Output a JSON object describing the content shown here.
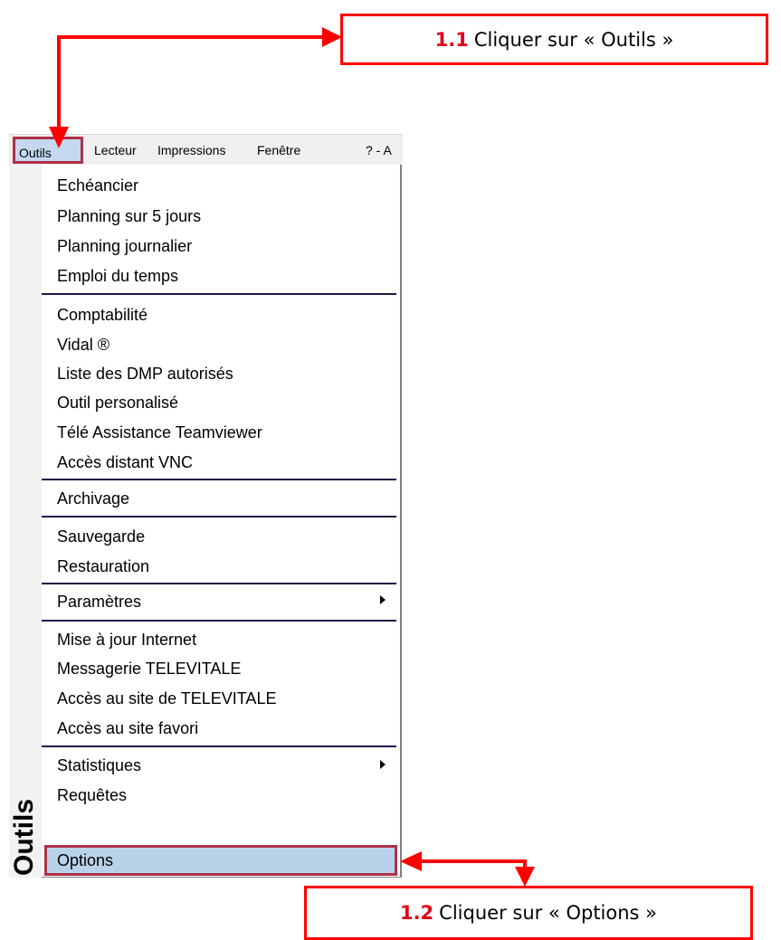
{
  "callouts": {
    "first": {
      "step": "1.1",
      "text": "Cliquer sur « Outils »"
    },
    "second": {
      "step": "1.2",
      "text": "Cliquer sur « Options »"
    }
  },
  "menubar": {
    "items": [
      "Outils",
      "Lecteur",
      "Impressions",
      "Fenêtre",
      "? - A"
    ]
  },
  "sidebar": {
    "label": "Outils"
  },
  "menu": {
    "groups": [
      [
        "Echéancier",
        "Planning sur 5 jours",
        "Planning journalier",
        "Emploi du temps"
      ],
      [
        "Comptabilité",
        "Vidal ®",
        "Liste des DMP autorisés",
        "Outil personalisé",
        "Télé Assistance Teamviewer",
        "Accès distant VNC"
      ],
      [
        "Archivage"
      ],
      [
        "Sauvegarde",
        "Restauration"
      ],
      [
        "Paramètres"
      ],
      [
        "Mise à jour Internet",
        "Messagerie TELEVITALE",
        "Accès au site de TELEVITALE",
        "Accès au site favori"
      ],
      [
        "Statistiques",
        "Requêtes",
        "Options"
      ]
    ],
    "submenu_items": [
      "Paramètres",
      "Statistiques"
    ],
    "highlighted_item": "Options"
  },
  "colors": {
    "annotation_red": "#ff0000",
    "highlight_border": "#b03048",
    "highlight_fill": "#b9d2ea"
  }
}
